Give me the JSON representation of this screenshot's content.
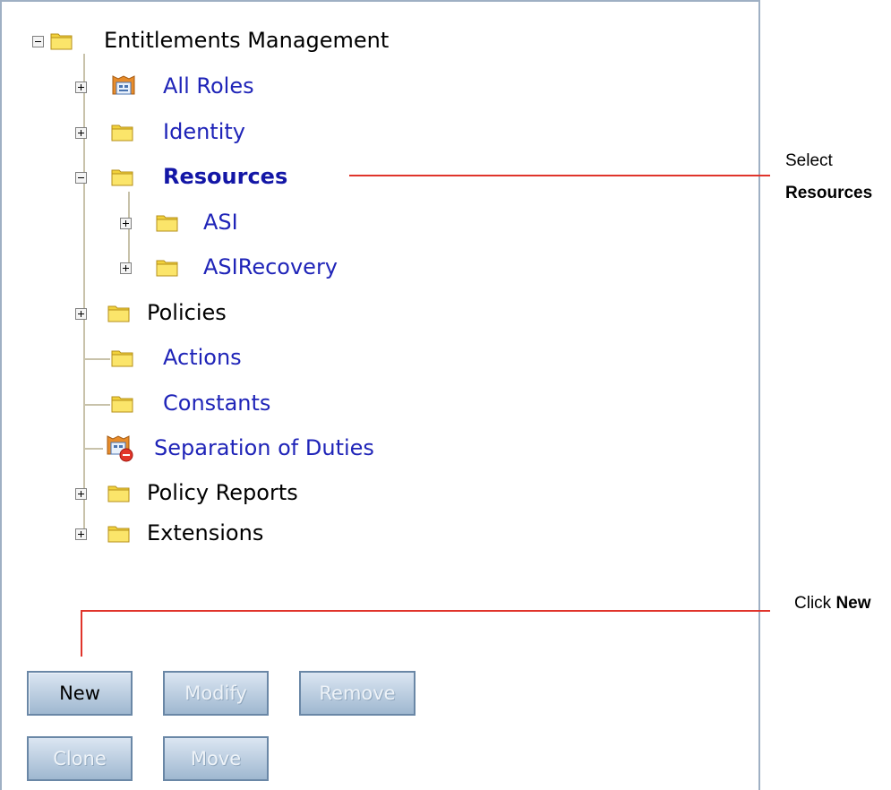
{
  "tree": {
    "root": "Entitlements Management",
    "all_roles": "All Roles",
    "identity": "Identity",
    "resources": "Resources",
    "asi": "ASI",
    "asi_recovery": "ASIRecovery",
    "policies": "Policies",
    "actions": "Actions",
    "constants": "Constants",
    "separation_of_duties": "Separation of Duties",
    "policy_reports": "Policy Reports",
    "extensions": "Extensions"
  },
  "buttons": {
    "new": "New",
    "modify": "Modify",
    "remove": "Remove",
    "clone": "Clone",
    "move": "Move"
  },
  "callouts": {
    "select_prefix": "Select",
    "select_bold": "Resources",
    "click_prefix": "Click",
    "click_bold": "New"
  },
  "colors": {
    "link": "#1f24b8",
    "callout_line": "#e0342b",
    "folder": "#f2d23c"
  }
}
